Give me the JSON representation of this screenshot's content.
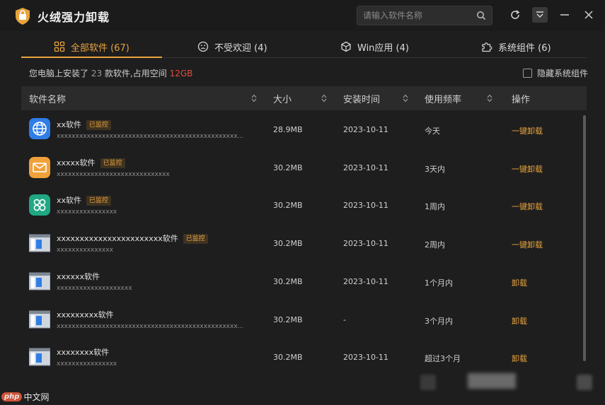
{
  "app": {
    "title": "火绒强力卸载",
    "accent": "#e8a33c",
    "search_placeholder": "请输入软件名称",
    "buttons": [
      "refresh-icon",
      "menu-icon",
      "minimize-icon",
      "close-icon"
    ]
  },
  "tabs": [
    {
      "label": "全部软件 (67)",
      "icon": "grid-icon",
      "active": true
    },
    {
      "label": "不受欢迎 (4)",
      "icon": "frown-icon",
      "active": false
    },
    {
      "label": "Win应用 (4)",
      "icon": "cube-icon",
      "active": false
    },
    {
      "label": "系统组件 (6)",
      "icon": "puzzle-icon",
      "active": false
    }
  ],
  "summary": {
    "prefix": "您电脑上安装了 ",
    "count": "23",
    "middle": " 款软件,占用空间 ",
    "size": "12GB"
  },
  "hide_system_label": "隐藏系统组件",
  "columns": [
    "软件名称",
    "大小",
    "安装时间",
    "使用频率",
    "操作"
  ],
  "rows": [
    {
      "name": "xx软件",
      "badge": "已监控",
      "sub": "xxxxxxxxxxxxxxxxxxxxxxxxxxxxxxxxxxxxxxxxxxxxxxxx...",
      "size": "28.9MB",
      "date": "2023-10-11",
      "freq": "今天",
      "action": "一键卸载",
      "icon": "globe-icon"
    },
    {
      "name": "xxxxx软件",
      "badge": "已监控",
      "sub": "xxxxxxxxxxxxxxxxxxxxxxxxxxxxxx",
      "size": "30.2MB",
      "date": "2023-10-11",
      "freq": "3天内",
      "action": "一键卸载",
      "icon": "mail-icon"
    },
    {
      "name": "xx软件",
      "badge": "已监控",
      "sub": "xxxxxxxxxxxxxxxx",
      "size": "30.2MB",
      "date": "2023-10-11",
      "freq": "1周内",
      "action": "一键卸载",
      "icon": "apps-icon"
    },
    {
      "name": "xxxxxxxxxxxxxxxxxxxxxxx软件",
      "badge": "已监控",
      "sub": "xxxxxxxxxxxxxxx",
      "size": "30.2MB",
      "date": "2023-10-11",
      "freq": "2周内",
      "action": "一键卸载",
      "icon": "window-icon"
    },
    {
      "name": "xxxxxx软件",
      "badge": "",
      "sub": "xxxxxxxxxxxxxxxxxxxx",
      "size": "30.2MB",
      "date": "2023-10-11",
      "freq": "1个月内",
      "action": "卸载",
      "icon": "window-icon"
    },
    {
      "name": "xxxxxxxxx软件",
      "badge": "",
      "sub": "xxxxxxxxxxxxxxxxxxxxxxxxxxxxxxxxxxxxxxxxxxxxxxxx...",
      "size": "30.2MB",
      "date": "-",
      "freq": "3个月内",
      "action": "卸载",
      "icon": "window-icon"
    },
    {
      "name": "xxxxxxxx软件",
      "badge": "",
      "sub": "xxxxxxxxxxxxxxxx",
      "size": "30.2MB",
      "date": "2023-10-11",
      "freq": "超过3个月",
      "action": "卸载",
      "icon": "window-icon"
    }
  ],
  "watermark": {
    "logo": "php",
    "text": "中文网"
  }
}
